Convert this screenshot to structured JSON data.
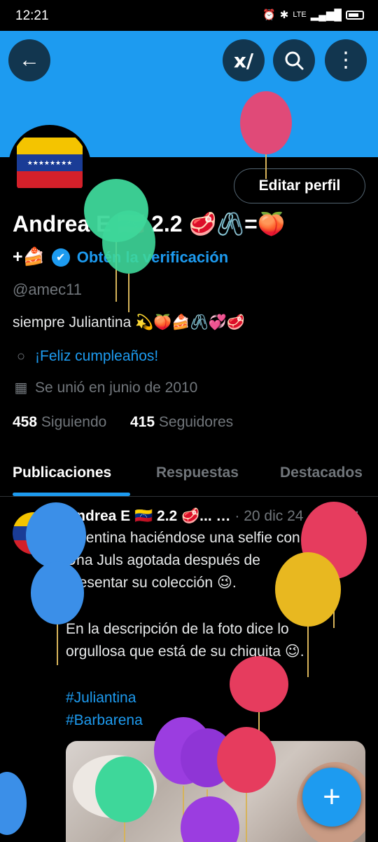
{
  "status_bar": {
    "time": "12:21",
    "network": "LTE"
  },
  "header": {
    "back_icon": "arrow-left-icon",
    "grok_icon": "grok-icon",
    "search_icon": "search-icon",
    "more_icon": "more-vertical-icon"
  },
  "profile": {
    "edit_label": "Editar perfil",
    "name_line1": "Andrea E 🇻🇪 2.2 🥩🖇️=🍑",
    "name_line2_prefix": "+🍰",
    "verify_label": "Obtén la verificación",
    "handle": "@amec11",
    "bio": "siempre Juliantina 💫🍑🍰🖇️💞🥩",
    "birthday": "¡Feliz cumpleaños!",
    "joined": "Se unió en junio de 2010",
    "following_count": "458",
    "following_label": "Siguiendo",
    "followers_count": "415",
    "followers_label": "Seguidores"
  },
  "tabs": [
    "Publicaciones",
    "Respuestas",
    "Destacados"
  ],
  "post": {
    "author": "Andrea E 🇻🇪 2.2 🥩... …",
    "date": "· 20 dic 24",
    "lines": [
      "Valentina haciéndose una selfie con",
      "Una Juls agotada después de",
      "presentar su colección 😉.",
      "En la descripción de la foto dice lo",
      "orgullosa que está de su chiquita 😉."
    ],
    "hashtags": [
      "#Juliantina",
      "#Barbarena"
    ]
  },
  "fab_icon": "plus-icon",
  "colors": {
    "accent": "#1d9bf0",
    "background": "#000000",
    "muted": "#71767b"
  }
}
